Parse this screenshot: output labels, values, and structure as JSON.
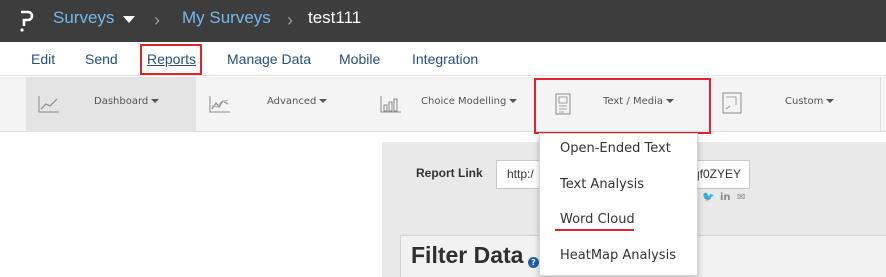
{
  "header": {
    "breadcrumbs": [
      "Surveys",
      "My Surveys",
      "test111"
    ]
  },
  "menu": {
    "items": [
      "Edit",
      "Send",
      "Reports",
      "Manage Data",
      "Mobile",
      "Integration"
    ]
  },
  "toolbar": {
    "items": [
      {
        "label": "Dashboard",
        "icon": "line-chart-icon"
      },
      {
        "label": "Advanced",
        "icon": "advanced-chart-icon"
      },
      {
        "label": "Choice Modelling",
        "icon": "choice-modelling-icon"
      },
      {
        "label": "Text / Media",
        "icon": "text-media-icon"
      },
      {
        "label": "Custom",
        "icon": "custom-report-icon"
      }
    ]
  },
  "report": {
    "link_label": "Report Link",
    "link_value_start": "http:/",
    "link_value_end": "qf0ZYEY"
  },
  "filter": {
    "title": "Filter Data"
  },
  "dropdown": {
    "items": [
      "Open-Ended Text",
      "Text Analysis",
      "Word Cloud",
      "HeatMap Analysis"
    ]
  },
  "colors": {
    "topbar": "#3d3d3d",
    "link": "#74b9ec",
    "menu_text": "#2a4f7c",
    "highlight": "#e0242b"
  }
}
